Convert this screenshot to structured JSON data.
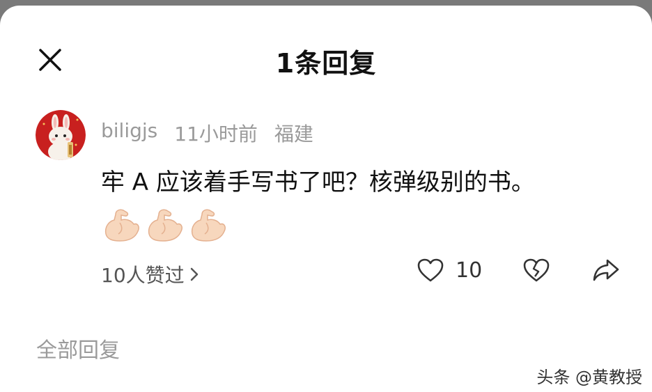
{
  "header": {
    "title": "1条回复",
    "close_icon": "close-icon"
  },
  "comment": {
    "username": "biligjs",
    "time": "11小时前",
    "location": "福建",
    "text": "牢 A 应该着手写书了吧？核弹级别的书。",
    "emojis": [
      "flexed-biceps-icon",
      "flexed-biceps-icon",
      "flexed-biceps-icon"
    ],
    "likes_summary": "10人赞过",
    "like_count": "10",
    "actions": [
      "heart-icon",
      "broken-heart-icon",
      "share-icon"
    ]
  },
  "section": {
    "title": "全部回复"
  },
  "watermark": "头条 @黄教授",
  "colors": {
    "muted": "#9a9a9a",
    "text": "#111111",
    "avatar_bg": "#c8201f"
  }
}
